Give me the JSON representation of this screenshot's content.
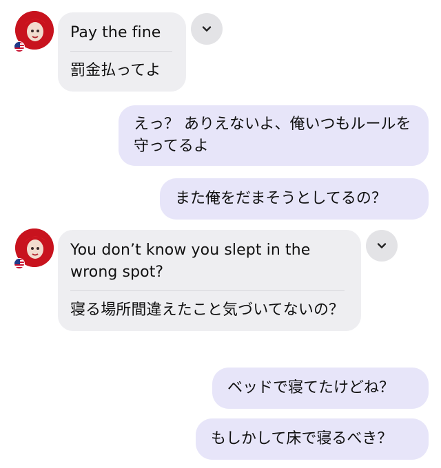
{
  "messages": [
    {
      "from": "other",
      "original": "Pay the fine",
      "translation": "罰金払ってよ"
    },
    {
      "from": "me",
      "text": "えっ？ ありえないよ、俺いつもルールを守ってるよ"
    },
    {
      "from": "me",
      "text": "また俺をだまそうとしてるの？"
    },
    {
      "from": "other",
      "original": "You don’t know you slept in the wrong spot?",
      "translation": "寝る場所間違えたこと気づいてないの？"
    },
    {
      "from": "me",
      "text": "ベッドで寝てたけどね？"
    },
    {
      "from": "me",
      "text": "もしかして床で寝るべき？"
    }
  ],
  "icons": {
    "expand": "chevron-down-icon",
    "sender_flag": "us-flag-icon",
    "avatar": "avatar-red-hair"
  },
  "colors": {
    "incoming_bubble": "#eeeef1",
    "outgoing_bubble": "#e7e5f9",
    "chevron_button": "#e3e3e6"
  }
}
